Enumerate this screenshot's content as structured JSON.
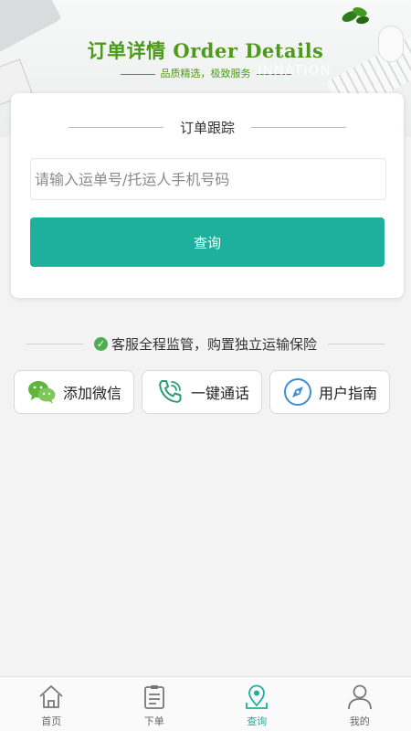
{
  "banner": {
    "title": "订单详情 Order Details",
    "subtitle": "品质精选，极致服务",
    "ghost_text": "INNATION"
  },
  "card": {
    "title": "订单跟踪",
    "input_placeholder": "请输入运单号/托运人手机号码",
    "input_value": "",
    "button_label": "查询"
  },
  "notice": {
    "text": "客服全程监管，购置独立运输保险"
  },
  "actions": [
    {
      "label": "添加微信",
      "icon": "wechat-icon"
    },
    {
      "label": "一键通话",
      "icon": "phone-icon"
    },
    {
      "label": "用户指南",
      "icon": "compass-icon"
    }
  ],
  "tabbar": {
    "active_index": 2,
    "items": [
      {
        "label": "首页",
        "icon": "home-icon"
      },
      {
        "label": "下单",
        "icon": "clipboard-icon"
      },
      {
        "label": "查询",
        "icon": "location-icon"
      },
      {
        "label": "我的",
        "icon": "user-icon"
      }
    ]
  },
  "colors": {
    "accent": "#1db09c",
    "brand_green": "#4d9a1b",
    "check_green": "#4caf50"
  }
}
